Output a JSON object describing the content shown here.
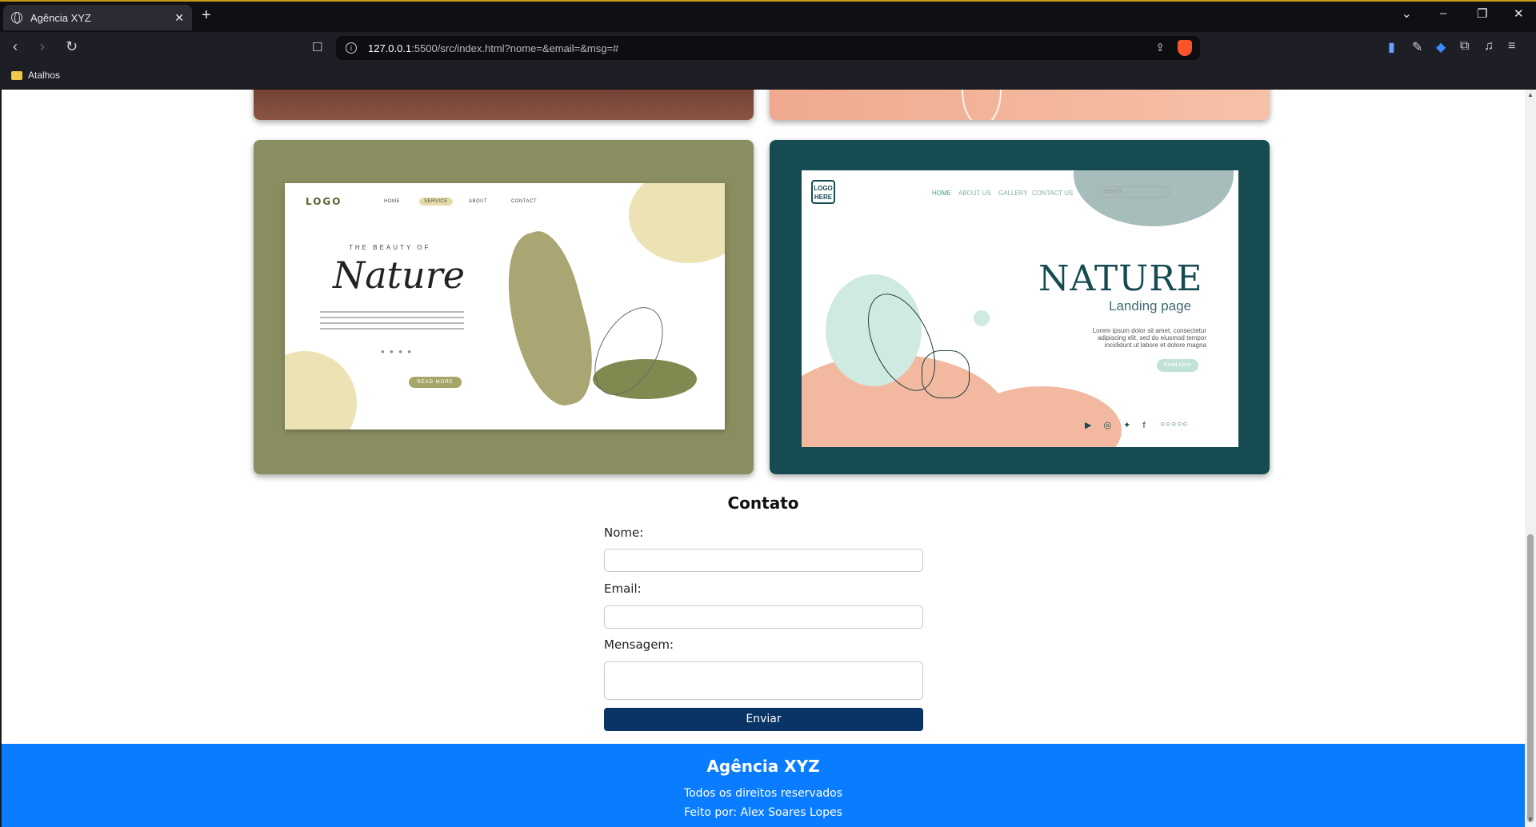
{
  "browser": {
    "tab_title": "Agência XYZ",
    "tab_close": "✕",
    "new_tab": "+",
    "url_host": "127.0.0.1",
    "url_path": ":5500/src/index.html?nome=&email=&msg=#",
    "bookmark_folder": "Atalhos",
    "window_controls": {
      "dropdown": "⌄",
      "minimize": "–",
      "restore": "❐",
      "close": "✕"
    }
  },
  "portfolio": {
    "green_mock": {
      "logo": "LOGO",
      "nav": [
        "HOME",
        "SERVICE",
        "ABOUT",
        "CONTACT"
      ],
      "subtitle": "THE BEAUTY OF",
      "title": "Nature",
      "dots": "● ● ● ●",
      "button": "READ MORE"
    },
    "teal_mock": {
      "logo": "LOGO HERE",
      "nav": [
        "HOME",
        "ABOUT US",
        "GALLERY",
        "CONTACT US"
      ],
      "search_placeholder": "Search",
      "title": "NATURE",
      "subtitle": "Landing page",
      "lorem": "Lorem ipsum dolor sit amet, consectetur adipiscing elit, sed do eiusmod tempor incididunt ut labore et dolore magna",
      "button": "Read More",
      "social": "▶ ◎ ✦ f",
      "circles": "○○○○○"
    }
  },
  "contact": {
    "title": "Contato",
    "name_label": "Nome:",
    "name_value": "",
    "email_label": "Email:",
    "email_value": "",
    "message_label": "Mensagem:",
    "message_value": "",
    "submit_label": "Enviar"
  },
  "footer": {
    "agency": "Agência XYZ",
    "rights": "Todos os direitos reservados",
    "author": "Feito por: Alex Soares Lopes"
  },
  "colors": {
    "footer_bg": "#0a7cff",
    "submit_bg": "#0b3466",
    "card_green": "#8a8d5f",
    "card_teal": "#174b52"
  }
}
